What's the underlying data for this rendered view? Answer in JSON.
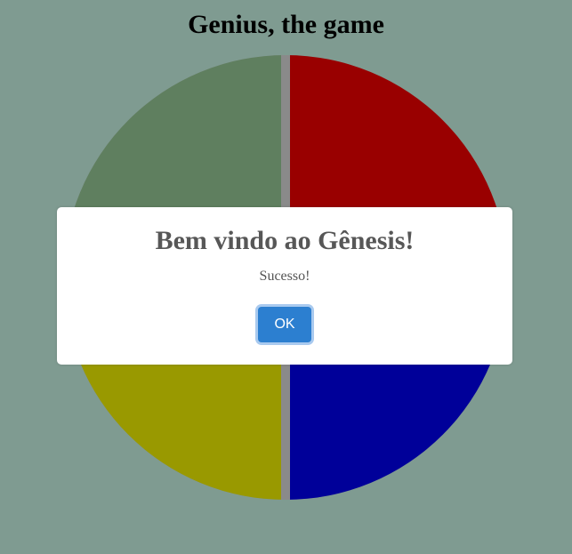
{
  "page": {
    "title": "Genius, the game"
  },
  "board": {
    "quadrants": [
      {
        "name": "green",
        "color": "#5f7f5f"
      },
      {
        "name": "red",
        "color": "#990000"
      },
      {
        "name": "yellow",
        "color": "#999900"
      },
      {
        "name": "blue",
        "color": "#000099"
      }
    ],
    "divider_color": "#8a8a8a"
  },
  "modal": {
    "title": "Bem vindo ao Gênesis!",
    "text": "Sucesso!",
    "ok_label": "OK"
  },
  "colors": {
    "background": "#7f9b91",
    "button": "#2c7fd0"
  }
}
